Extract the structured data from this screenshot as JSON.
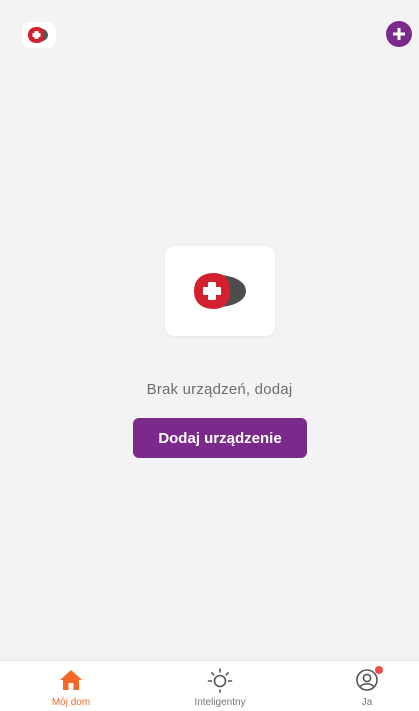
{
  "header": {
    "logo_icon": "app-logo-icon",
    "add_icon": "plus-circle-icon",
    "accent_color": "#7b2a8c"
  },
  "empty_state": {
    "logo_icon": "app-logo-icon",
    "message": "Brak urządzeń, dodaj",
    "button_label": "Dodaj urządzenie"
  },
  "bottom_nav": {
    "items": [
      {
        "label": "Mój dom",
        "icon": "home-icon",
        "active": true
      },
      {
        "label": "Inteligentny",
        "icon": "sun-icon",
        "active": false
      },
      {
        "label": "Ja",
        "icon": "user-icon",
        "badge": true,
        "active": false
      }
    ],
    "active_color": "#f26a26"
  }
}
